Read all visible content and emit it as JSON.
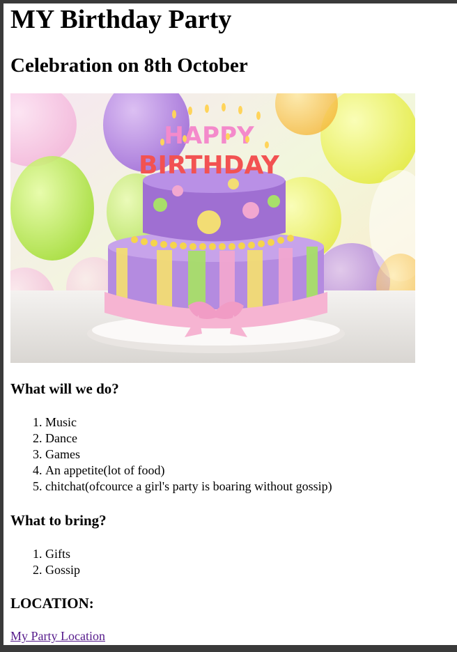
{
  "title": "MY Birthday Party",
  "subtitle": "Celebration on 8th October",
  "image": {
    "alt": "Birthday cake",
    "topper_line1": "HAPPY",
    "topper_line2": "BIRTHDAY"
  },
  "activities": {
    "heading": "What will we do?",
    "items": [
      "Music",
      "Dance",
      "Games",
      "An appetite(lot of food)",
      "chitchat(ofcource a girl's party is boaring without gossip)"
    ]
  },
  "bring": {
    "heading": "What to bring?",
    "items": [
      "Gifts",
      "Gossip"
    ]
  },
  "location": {
    "heading": "LOCATION:",
    "link_text": "My Party Location"
  },
  "colors": {
    "link_visited": "#551a8b",
    "frame": "#3a3a3a"
  }
}
